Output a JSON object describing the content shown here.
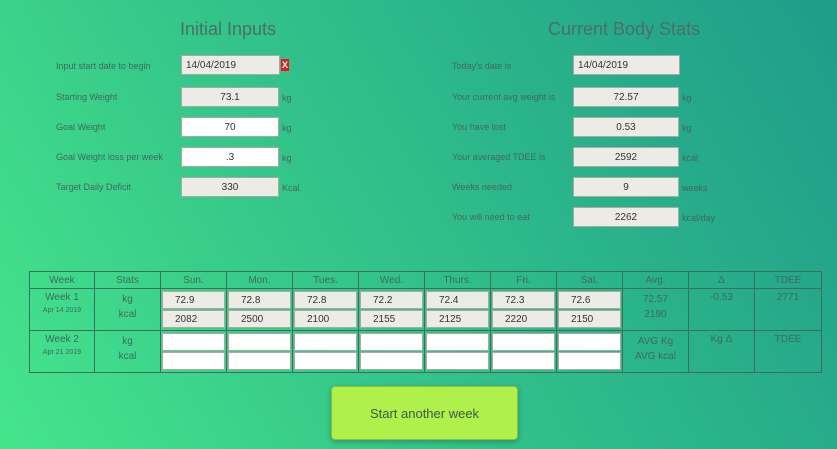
{
  "initial": {
    "title": "Initial Inputs",
    "start_label": "Input start date to begin",
    "start_value": "14/04/2019",
    "clear_glyph": "X",
    "starting_weight_label": "Starting Weight",
    "starting_weight_value": "73.1",
    "goal_weight_label": "Goal Weight",
    "goal_weight_value": "70",
    "loss_label": "Goal Weight loss per week",
    "loss_value": ".3",
    "deficit_label": "Target Daily Deficit",
    "deficit_value": "330",
    "unit_kg": "kg",
    "unit_kcal": "Kcal."
  },
  "current": {
    "title": "Current Body Stats",
    "today_label": "Today's date is",
    "today_value": "14/04/2019",
    "avg_label": "Your current avg weight is",
    "avg_value": "72.57",
    "lost_label": "You have lost",
    "lost_value": "0.53",
    "tdee_label": "Your averaged TDEE is",
    "tdee_value": "2592",
    "weeks_label": "Weeks needed",
    "weeks_value": "9",
    "eat_label": "You will need to eat",
    "eat_value": "2262",
    "unit_kg": "kg",
    "unit_kcal": "kcal",
    "unit_weeks": "weeks",
    "unit_kcalday": "kcal/day"
  },
  "table": {
    "headers": [
      "Week",
      "Stats",
      "Sun.",
      "Mon.",
      "Tues.",
      "Wed.",
      "Thurs.",
      "Fri.",
      "Sat.",
      "Avg.",
      "Δ",
      "TDEE"
    ],
    "week1": {
      "name": "Week 1",
      "date": "Apr 14 2019",
      "stat_kg": "kg",
      "stat_kcal": "kcal",
      "kg": [
        "72.9",
        "72.8",
        "72.8",
        "72.2",
        "72.4",
        "72.3",
        "72.6"
      ],
      "kcal": [
        "2082",
        "2500",
        "2100",
        "2155",
        "2125",
        "2220",
        "2150"
      ],
      "avg_kg": "72.57",
      "avg_kcal": "2190",
      "delta": "-0.53",
      "tdee": "2771"
    },
    "week2": {
      "name": "Week 2",
      "date": "Apr 21 2019",
      "stat_kg": "kg",
      "stat_kcal": "kcal",
      "avg_kg": "AVG Kg",
      "avg_kcal": "AVG kcal",
      "delta": "Kg Δ",
      "tdee": "TDEE"
    }
  },
  "button": {
    "label": "Start another week"
  }
}
